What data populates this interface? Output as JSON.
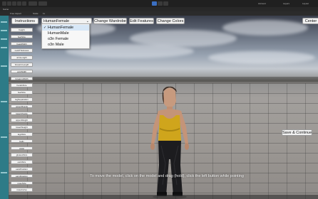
{
  "editor": {
    "toolbar_left_labels": [
      "Account",
      "Layers",
      "Layout"
    ],
    "game_tab_label": "Game",
    "game_options": [
      "Free Aspect",
      "Scale",
      "1x"
    ]
  },
  "game": {
    "buttons": {
      "instructions": "Instructions",
      "change_wardrobe": "Change Wardrobe",
      "edit_features": "Edit Features",
      "change_colors": "Change Colors",
      "center": "Center",
      "save_continue": "Save & Continue"
    },
    "dropdown": {
      "selected": "HumanFemale",
      "options": [
        "HumanFemale",
        "HumanMale",
        "o3n Female",
        "o3n Male"
      ],
      "checked_index": 0
    },
    "sliders": [
      "height",
      "feetSize",
      "headWidth",
      "neckThickness",
      "armLength",
      "forearmLength",
      "armWidth",
      "forearmWidth",
      "handsSize",
      "feetSize",
      "legSeparation",
      "upperMuscle",
      "lowerMuscle",
      "upperWeight",
      "lowerWeight",
      "legsSize",
      "belly",
      "waist",
      "gluteusSize",
      "earsSize",
      "earsPosition",
      "earsRotation",
      "noseSize",
      "noseCurve"
    ],
    "instruction_text": "To move the model, click on the model and drag (hold), click the left button while pointing"
  }
}
